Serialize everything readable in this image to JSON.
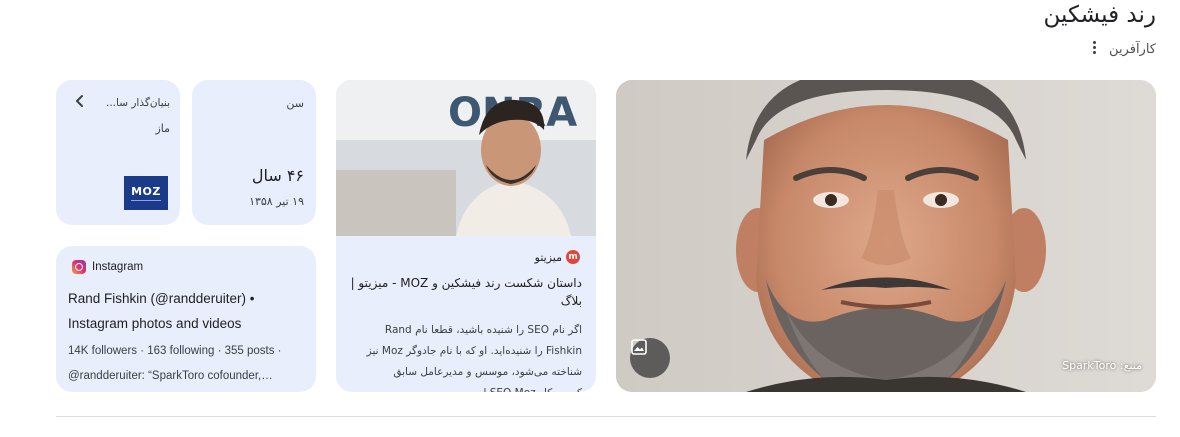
{
  "header": {
    "title": "رند فیشکین",
    "subtitle": "کارآفرین"
  },
  "hero": {
    "source": "منبع: SparkToro",
    "image_button_icon": "image-icon"
  },
  "article": {
    "publisher": "میزیتو",
    "title": "داستان شکست رند فیشکین و MOZ - میزیتو | بلاگ",
    "snippet": "اگر نام SEO را شنیده باشید، قطعا نام Rand Fishkin را شنیده‌اید. او که با نام جادوگر Moz نیز شناخته می‌شود، موسس و مدیرعامل سابق کسب‌وکار SEO Moz است."
  },
  "age": {
    "label": "سن",
    "value": "۴۶ سال",
    "birth_date": "۱۹ تیر ۱۳۵۸"
  },
  "founder": {
    "label": "بنیان‌گذار سا...",
    "value": "ماز",
    "logo_text": "MOZ"
  },
  "instagram": {
    "site": "Instagram",
    "title": "Rand Fishkin (@randderuiter) • Instagram photos and videos",
    "stats": "14K followers · 163 following · 355 posts ·",
    "snippet": "@randderuiter: “SparkToro cofounder,…"
  },
  "colors": {
    "card_bg": "#e8eefb",
    "moz_blue": "#1b3a8a",
    "publisher_red": "#e2453c"
  }
}
